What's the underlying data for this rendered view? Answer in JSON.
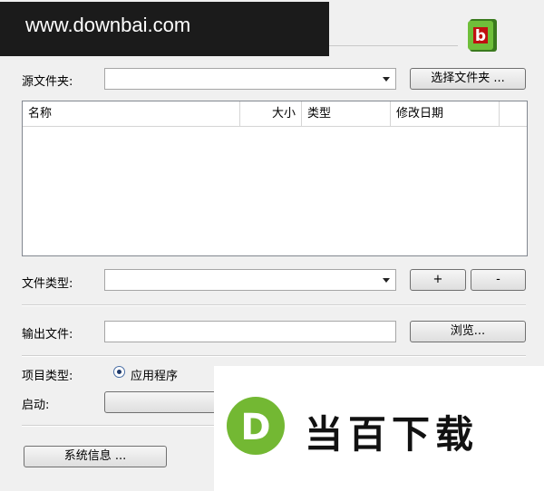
{
  "banner": {
    "text": "www.downbai.com"
  },
  "logo": {
    "letter": "b",
    "color": "#c01010"
  },
  "source_folder": {
    "label": "源文件夹:",
    "value": "",
    "browse_label": "选择文件夹 ..."
  },
  "file_list": {
    "columns": [
      "名称",
      "大小",
      "类型",
      "修改日期"
    ],
    "rows": []
  },
  "file_type": {
    "label": "文件类型:",
    "value": "",
    "add_label": "+",
    "remove_label": "-"
  },
  "output_file": {
    "label": "输出文件:",
    "value": "",
    "browse_label": "浏览..."
  },
  "project_type": {
    "label": "项目类型:",
    "selected": "应用程序"
  },
  "startup": {
    "label": "启动:"
  },
  "sysinfo": {
    "label": "系统信息 ..."
  },
  "watermark": {
    "letter": "D",
    "text": "当百下载",
    "color": "#73b833"
  }
}
